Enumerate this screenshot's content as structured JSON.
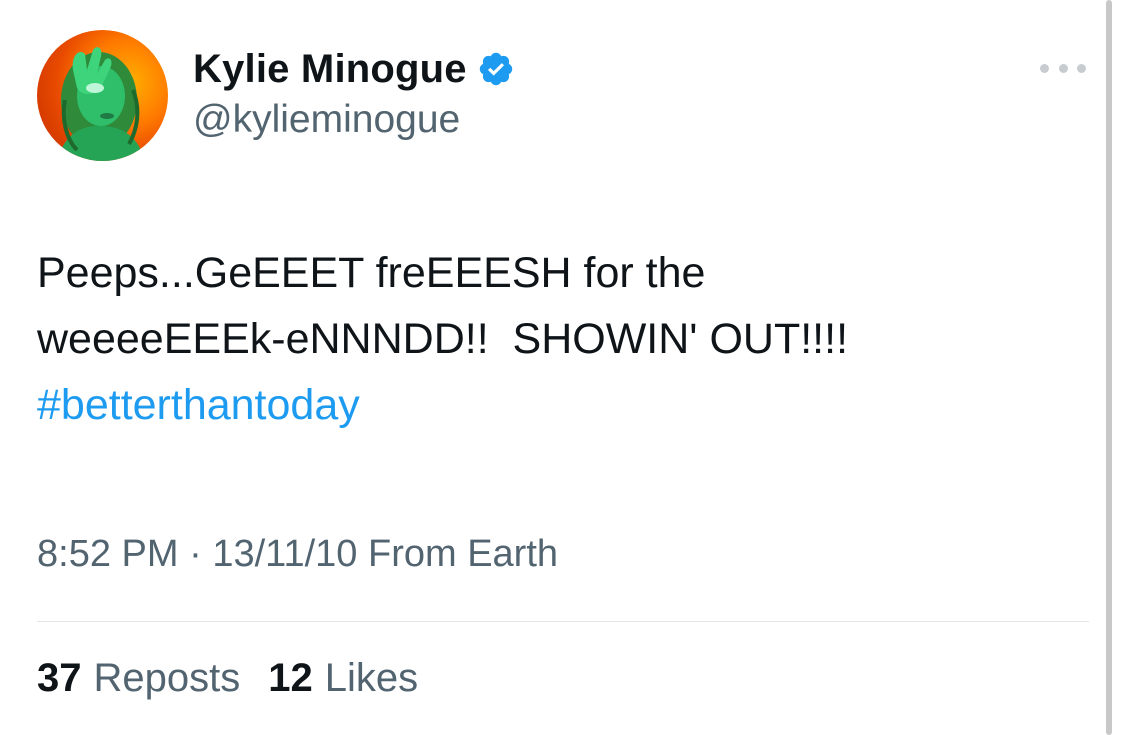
{
  "author": {
    "display_name": "Kylie Minogue",
    "handle": "@kylieminogue",
    "verified": true
  },
  "tweet": {
    "line1": "Peeps...GeEEET freEEESH for the",
    "line2": "weeeeEEEk-eNNNDD!!  SHOWIN' OUT!!!!",
    "hashtag": "#betterthantoday"
  },
  "meta": {
    "time": "8:52 PM",
    "separator": "·",
    "date": "13/11/10",
    "source": "From Earth"
  },
  "stats": {
    "reposts_count": "37",
    "reposts_label": "Reposts",
    "likes_count": "12",
    "likes_label": "Likes"
  },
  "colors": {
    "accent": "#1d9bf0",
    "text_primary": "#0f1419",
    "text_secondary": "#536471"
  },
  "icons": {
    "verified": "verified-badge-icon",
    "more": "more-options-icon"
  }
}
